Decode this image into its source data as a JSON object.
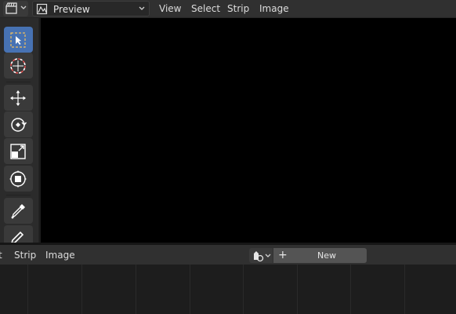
{
  "top_header": {
    "editor_type_icon": "sequencer-clapper-icon",
    "view_mode": "Preview",
    "menus": [
      "View",
      "Select",
      "Strip",
      "Image"
    ]
  },
  "toolbar": {
    "tools": [
      {
        "name": "select-box",
        "icon": "select-box-icon",
        "active": true
      },
      {
        "name": "cursor",
        "icon": "cursor-icon",
        "active": false
      },
      {
        "name": "move",
        "icon": "move-icon",
        "active": false
      },
      {
        "name": "rotate",
        "icon": "rotate-icon",
        "active": false
      },
      {
        "name": "scale",
        "icon": "scale-icon",
        "active": false
      },
      {
        "name": "transform",
        "icon": "transform-icon",
        "active": false
      },
      {
        "name": "sample",
        "icon": "eyedropper-icon",
        "active": false
      },
      {
        "name": "annotate",
        "icon": "pencil-icon",
        "active": false
      }
    ]
  },
  "bottom_header": {
    "menus": [
      "t",
      "Strip",
      "Image"
    ],
    "new_label": "New",
    "new_plus": "+"
  },
  "colors": {
    "active_tool": "#4772b3",
    "header_bg": "#303030",
    "viewport_bg": "#000000"
  }
}
